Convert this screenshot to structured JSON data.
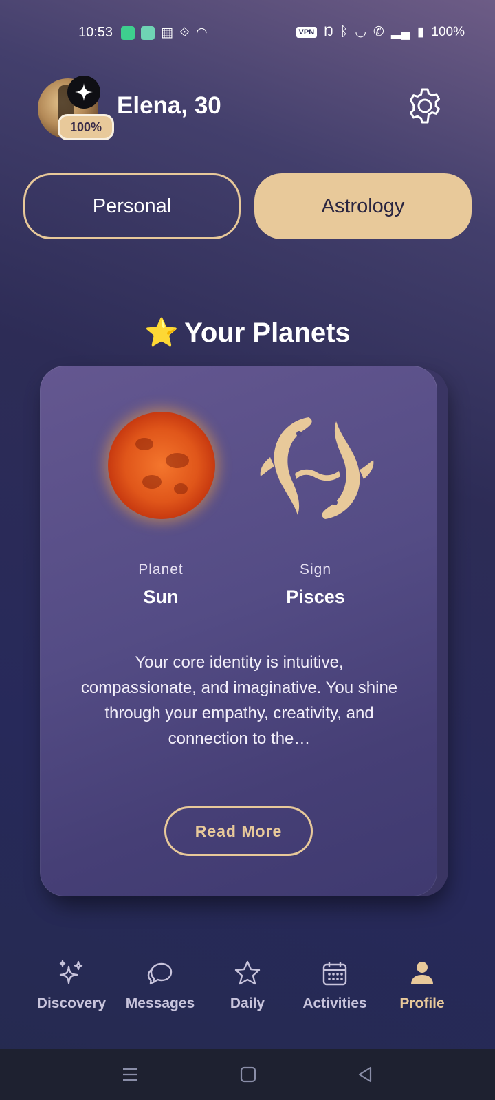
{
  "status_bar": {
    "time": "10:53",
    "vpn": "VPN",
    "battery": "100%"
  },
  "profile": {
    "name": "Elena, 30",
    "completion": "100%"
  },
  "tabs": [
    {
      "label": "Personal",
      "active": false
    },
    {
      "label": "Astrology",
      "active": true
    }
  ],
  "section": {
    "title": "Your Planets",
    "emoji": "⭐"
  },
  "card": {
    "planet_label": "Planet",
    "planet_value": "Sun",
    "sign_label": "Sign",
    "sign_value": "Pisces",
    "description": "Your core identity is intuitive, compassionate, and imaginative. You shine through your empathy, creativity, and connection to the…",
    "read_more": "Read More"
  },
  "bottom_nav": [
    {
      "label": "Discovery",
      "icon": "sparkles-icon"
    },
    {
      "label": "Messages",
      "icon": "chat-bubble-icon"
    },
    {
      "label": "Daily",
      "icon": "star-outline-icon"
    },
    {
      "label": "Activities",
      "icon": "calendar-icon"
    },
    {
      "label": "Profile",
      "icon": "person-icon",
      "active": true
    }
  ],
  "colors": {
    "accent": "#e8c99a",
    "background": "#2d2c56",
    "card": "#544c85"
  }
}
